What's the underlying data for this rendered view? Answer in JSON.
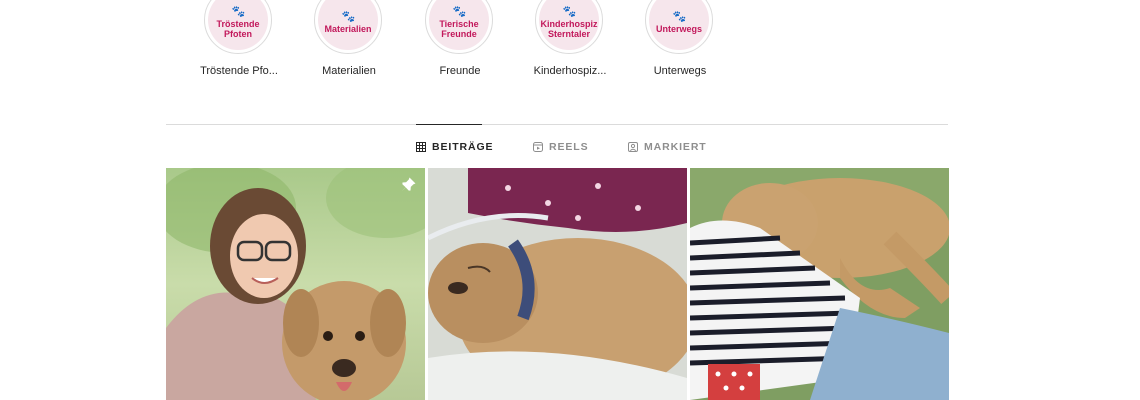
{
  "highlights": [
    {
      "cover_text": "Tröstende\nPfoten",
      "label": "Tröstende Pfo..."
    },
    {
      "cover_text": "Materialien",
      "label": "Materialien"
    },
    {
      "cover_text": "Tierische\nFreunde",
      "label": "Freunde"
    },
    {
      "cover_text": "Kinderhospiz\nSterntaler",
      "label": "Kinderhospiz..."
    },
    {
      "cover_text": "Unterwegs",
      "label": "Unterwegs"
    }
  ],
  "tabs": [
    {
      "label": "BEITRÄGE",
      "icon": "grid-icon",
      "active": true
    },
    {
      "label": "REELS",
      "icon": "reels-icon",
      "active": false
    },
    {
      "label": "MARKIERT",
      "icon": "tagged-icon",
      "active": false
    }
  ],
  "posts": [
    {
      "description": "woman with glasses and dog",
      "pinned": true
    },
    {
      "description": "dog sleeping next to child",
      "pinned": false
    },
    {
      "description": "child lying on dog",
      "pinned": false
    }
  ],
  "colors": {
    "accent_pink": "#c2185b",
    "highlight_bg": "#f6e6ec",
    "text_primary": "#262626",
    "text_secondary": "#8e8e8e",
    "divider": "#dbdbdb"
  }
}
